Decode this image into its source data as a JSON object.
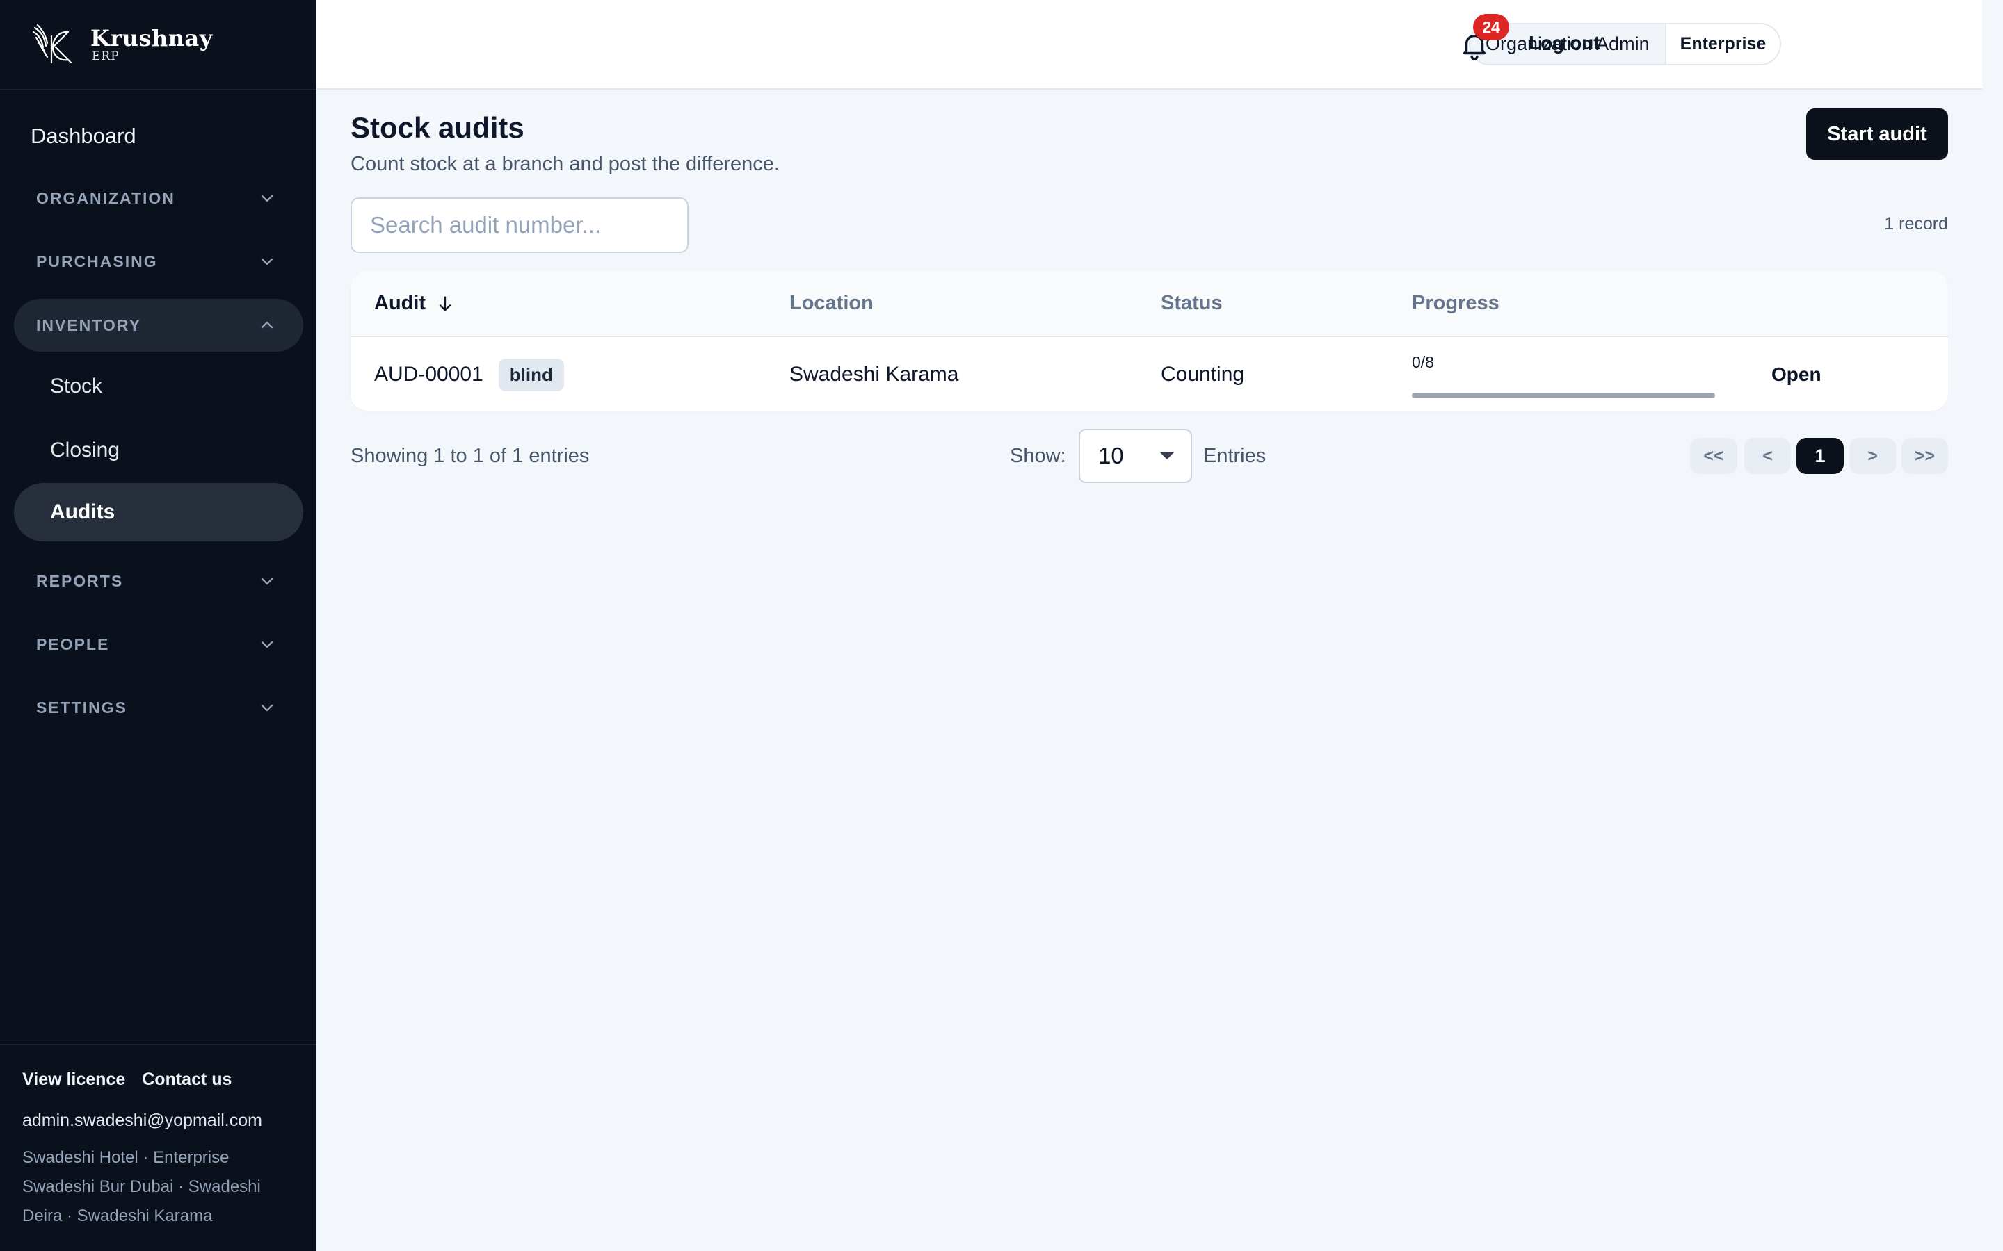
{
  "brand": {
    "name": "Krushnay",
    "sub": "ERP"
  },
  "sidebar": {
    "dashboard": "Dashboard",
    "groups": [
      {
        "label": "ORGANIZATION",
        "expanded": false
      },
      {
        "label": "PURCHASING",
        "expanded": false
      },
      {
        "label": "INVENTORY",
        "expanded": true,
        "items": [
          {
            "label": "Stock",
            "active": false
          },
          {
            "label": "Closing",
            "active": false
          },
          {
            "label": "Audits",
            "active": true
          }
        ]
      },
      {
        "label": "REPORTS",
        "expanded": false
      },
      {
        "label": "PEOPLE",
        "expanded": false
      },
      {
        "label": "SETTINGS",
        "expanded": false
      }
    ],
    "footer": {
      "view_licence": "View licence",
      "contact_us": "Contact us",
      "email": "admin.swadeshi@yopmail.com",
      "org_line": "Swadeshi Hotel · Enterprise",
      "branches_line": "Swadeshi Bur Dubai · Swadeshi Deira · Swadeshi Karama"
    }
  },
  "topbar": {
    "role": "Organization Admin",
    "tier": "Enterprise",
    "notification_count": "24",
    "logout": "Log out"
  },
  "page": {
    "title": "Stock audits",
    "subtitle": "Count stock at a branch and post the difference.",
    "start_button": "Start audit",
    "search_placeholder": "Search audit number...",
    "record_count": "1 record"
  },
  "table": {
    "columns": {
      "audit": "Audit",
      "location": "Location",
      "status": "Status",
      "progress": "Progress"
    },
    "rows": [
      {
        "audit": "AUD-00001",
        "tag": "blind",
        "location": "Swadeshi Karama",
        "status": "Counting",
        "progress_text": "0/8",
        "progress_fraction": 0,
        "action": "Open"
      }
    ]
  },
  "pagination": {
    "showing": "Showing 1 to 1 of 1 entries",
    "show_label": "Show:",
    "page_size": "10",
    "entries_label": "Entries",
    "first": "<<",
    "prev": "<",
    "current": "1",
    "next": ">",
    "last": ">>"
  },
  "colors": {
    "sidebar_bg": "#0a111c",
    "primary": "#0b121c",
    "badge": "#dc2626",
    "page_bg": "#f3f6fb"
  }
}
